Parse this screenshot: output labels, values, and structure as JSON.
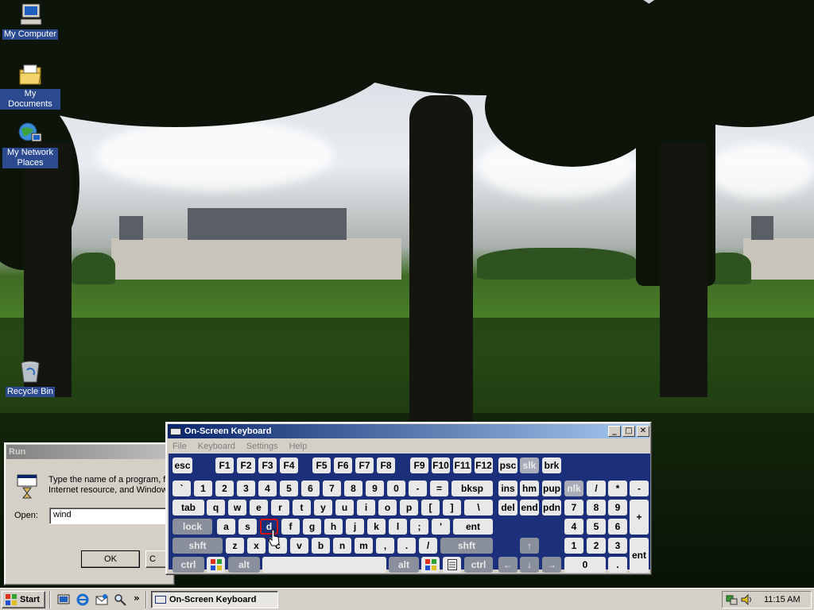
{
  "desktop": {
    "icons": [
      {
        "label": "My Computer",
        "icon": "my-computer-icon"
      },
      {
        "label": "My Documents",
        "icon": "my-documents-icon"
      },
      {
        "label": "My Network Places",
        "icon": "network-places-icon"
      },
      {
        "label": "Recycle Bin",
        "icon": "recycle-bin-icon"
      }
    ]
  },
  "run_dialog": {
    "title": "Run",
    "description_line1": "Type the name of a program, f",
    "description_line2": "Internet resource, and Window",
    "open_label": "Open:",
    "open_value": "wind",
    "ok_label": "OK",
    "cancel_label": "C"
  },
  "osk": {
    "title": "On-Screen Keyboard",
    "menu": [
      "File",
      "Keyboard",
      "Settings",
      "Help"
    ],
    "keys": {
      "esc": "esc",
      "f1": "F1",
      "f2": "F2",
      "f3": "F3",
      "f4": "F4",
      "f5": "F5",
      "f6": "F6",
      "f7": "F7",
      "f8": "F8",
      "f9": "F9",
      "f10": "F10",
      "f11": "F11",
      "f12": "F12",
      "psc": "psc",
      "slk": "slk",
      "brk": "brk",
      "grave": "`",
      "n1": "1",
      "n2": "2",
      "n3": "3",
      "n4": "4",
      "n5": "5",
      "n6": "6",
      "n7": "7",
      "n8": "8",
      "n9": "9",
      "n0": "0",
      "minus": "-",
      "equals": "=",
      "bksp": "bksp",
      "ins": "ins",
      "hm": "hm",
      "pup": "pup",
      "nlk": "nlk",
      "kp_slash": "/",
      "kp_star": "*",
      "kp_minus": "-",
      "tab": "tab",
      "q": "q",
      "w": "w",
      "e": "e",
      "r": "r",
      "t": "t",
      "y": "y",
      "u": "u",
      "i": "i",
      "o": "o",
      "p": "p",
      "lbracket": "[",
      "rbracket": "]",
      "backslash": "\\",
      "del": "del",
      "end": "end",
      "pdn": "pdn",
      "kp7": "7",
      "kp8": "8",
      "kp9": "9",
      "kp_plus": "+",
      "lock": "lock",
      "a": "a",
      "s": "s",
      "d": "d",
      "f": "f",
      "g": "g",
      "h": "h",
      "j": "j",
      "k": "k",
      "l": "l",
      "semicolon": ";",
      "quote": "'",
      "ent": "ent",
      "kp4": "4",
      "kp5": "5",
      "kp6": "6",
      "shft_l": "shft",
      "z": "z",
      "x": "x",
      "c": "c",
      "v": "v",
      "b": "b",
      "n": "n",
      "m": "m",
      "comma": ",",
      "period": ".",
      "slash": "/",
      "shft_r": "shft",
      "up": "↑",
      "kp1": "1",
      "kp2": "2",
      "kp3": "3",
      "kp_ent": "ent",
      "ctrl_l": "ctrl",
      "alt_l": "alt",
      "alt_r": "alt",
      "ctrl_r": "ctrl",
      "left": "←",
      "down": "↓",
      "right": "→",
      "kp0": "0",
      "kp_dot": "."
    },
    "highlighted_key": "d"
  },
  "taskbar": {
    "start_label": "Start",
    "task_label": "On-Screen Keyboard",
    "chevron": "»",
    "clock": "11:15 AM"
  },
  "colors": {
    "title_active": "#0a246a",
    "keyboard_bg": "#1c2f7a",
    "highlight": "#d01010"
  }
}
